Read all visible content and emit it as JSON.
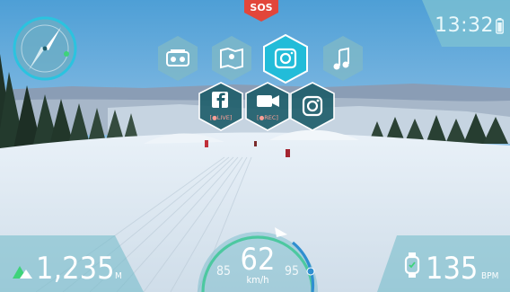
{
  "status_bar": {
    "time": "13:32",
    "sos_label": "SOS"
  },
  "compass": {
    "heading_deg": 35
  },
  "menu": {
    "top_row": [
      {
        "name": "radio",
        "icon": "radio-icon"
      },
      {
        "name": "map",
        "icon": "map-icon"
      },
      {
        "name": "camera",
        "icon": "camera-icon",
        "active": true
      },
      {
        "name": "music",
        "icon": "music-note-icon"
      }
    ],
    "bottom_row": [
      {
        "name": "facebook-live",
        "icon": "facebook-icon",
        "label": "[●LIVE]"
      },
      {
        "name": "video-rec",
        "icon": "video-camera-icon",
        "label": "[●REC]"
      },
      {
        "name": "instagram",
        "icon": "instagram-icon"
      }
    ]
  },
  "stats": {
    "altitude": {
      "value": "1,235",
      "unit": "M"
    },
    "speed": {
      "value": "62",
      "unit": "km/h",
      "left_value": "85",
      "right_value": "95"
    },
    "heart_rate": {
      "value": "135",
      "unit": "BPM"
    }
  },
  "colors": {
    "accent": "#2bc3df",
    "panel": "#6fb9c8",
    "sos": "#e2463a",
    "gauge": "#4cc8a0"
  }
}
